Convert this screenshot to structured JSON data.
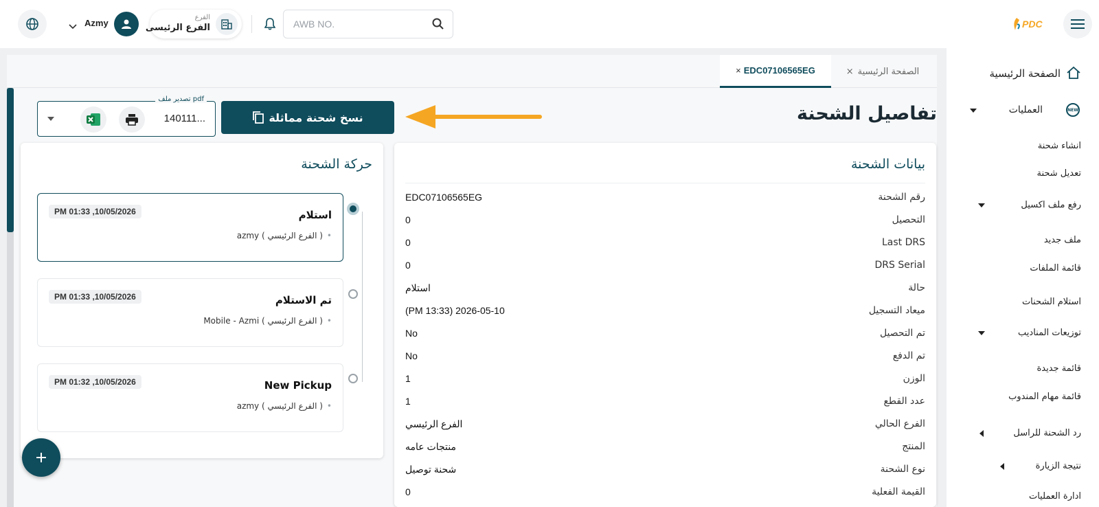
{
  "topbar": {
    "search_placeholder": "AWB NO.",
    "branch_label": "الفرع",
    "branch_value": "الفرع الرئيسى",
    "username": "Azmy",
    "logo_text": "PDC",
    "icons": [
      "menu-icon",
      "search-icon",
      "bell-icon",
      "building-icon",
      "user-icon",
      "globe-icon"
    ]
  },
  "sidebar": {
    "items": [
      {
        "label": "الصفحة الرئيسية",
        "icon": "home-icon"
      },
      {
        "label": "العمليات",
        "icon": "new-badge-icon"
      },
      {
        "label": "انشاء شحنة"
      },
      {
        "label": "تعديل شحنة"
      },
      {
        "label": "رفع ملف اكسيل"
      },
      {
        "label": "ملف جديد"
      },
      {
        "label": "قائمة الملفات"
      },
      {
        "label": "استلام الشحنات"
      },
      {
        "label": "توزيعات المناديب"
      },
      {
        "label": "قائمة جديدة"
      },
      {
        "label": "قائمة مهام المندوب"
      },
      {
        "label": "رد الشحنة للراسل"
      },
      {
        "label": "نتيجة الزيارة"
      },
      {
        "label": "ادارة العمليات"
      }
    ]
  },
  "tabs": [
    {
      "label": "الصفحة الرئيسية",
      "close": "×"
    },
    {
      "label": "EDC07106565EG",
      "close": "×"
    }
  ],
  "page": {
    "title": "تفاصيل الشحنة",
    "copy_button": "نسخ شحنة مماثلة",
    "export_legend": "تصدير ملف pdf",
    "export_value": "140111..."
  },
  "details": {
    "title": "بيانات الشحنة",
    "rows": [
      {
        "label": "رقم الشحنة",
        "value": "EDC07106565EG"
      },
      {
        "label": "التحصيل",
        "value": "0"
      },
      {
        "label": "Last DRS",
        "value": "0"
      },
      {
        "label": "DRS Serial",
        "value": "0"
      },
      {
        "label": "حالة",
        "value": "استلام"
      },
      {
        "label": "ميعاد التسجيل",
        "value": "(PM 13:33) 2026-05-10"
      },
      {
        "label": "تم التحصيل",
        "value": "No"
      },
      {
        "label": "تم الدفع",
        "value": "No"
      },
      {
        "label": "الوزن",
        "value": "1"
      },
      {
        "label": "عدد القطع",
        "value": "1"
      },
      {
        "label": "الفرع الحالي",
        "value": "الفرع الرئيسي"
      },
      {
        "label": "المنتج",
        "value": "منتجات عامه"
      },
      {
        "label": "نوع الشحنة",
        "value": "شحنة توصيل"
      },
      {
        "label": "القيمة الفعلية",
        "value": "0"
      }
    ]
  },
  "movement": {
    "title": "حركة الشحنة",
    "events": [
      {
        "title": "استلام",
        "sub": "azmy ( الفرع الرئيسي )",
        "time": "PM 01:33 ,10/05/2026"
      },
      {
        "title": "تم الاستلام",
        "sub": "Mobile - Azmi ( الفرع الرئيسي )",
        "time": "PM 01:33 ,10/05/2026"
      },
      {
        "title": "New Pickup",
        "sub": "azmy ( الفرع الرئيسي )",
        "time": "PM 01:32 ,10/05/2026"
      }
    ]
  },
  "colors": {
    "primary": "#0f4c5c",
    "accent_arrow": "#f5a623"
  }
}
